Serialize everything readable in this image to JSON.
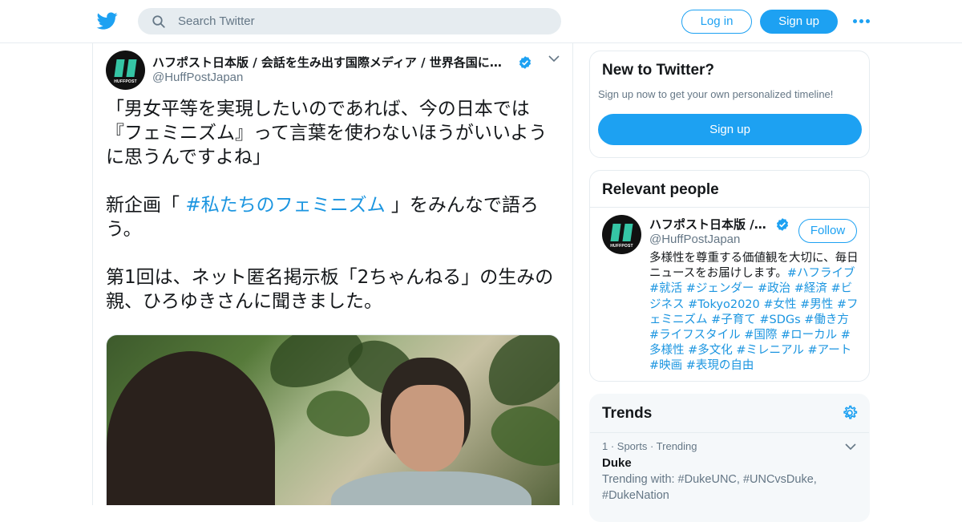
{
  "header": {
    "logo_icon": "twitter-bird-icon",
    "search_placeholder": "Search Twitter",
    "login_label": "Log in",
    "signup_label": "Sign up",
    "more_icon": "more-dots-icon",
    "accent_color": "#1da1f2"
  },
  "tweet": {
    "author_name": "ハフポスト日本版 / 会話を生み出す国際メディア / 世界各国に広がるネットワーク",
    "author_handle": "@HuffPostJapan",
    "avatar_label": "HUFFPOST",
    "verified_icon": "verified-badge-icon",
    "menu_icon": "chevron-down-icon",
    "text_p1": "「男女平等を実現したいのであれば、今の日本では『フェミニズム』って言葉を使わないほうがいいように思うんですよね」",
    "text_p2_before": "新企画「 ",
    "text_p2_hashtag": "#私たちのフェミニズム",
    "text_p2_after": " 」をみんなで語ろう。",
    "text_p3": "第1回は、ネット匿名掲示板「2ちゃんねる」の生みの親、ひろゆきさんに聞きました。",
    "media_type": "photo"
  },
  "sidebar": {
    "new_to_twitter": {
      "title": "New to Twitter?",
      "subtitle": "Sign up now to get your own personalized timeline!",
      "signup_label": "Sign up"
    },
    "relevant_people": {
      "title": "Relevant people",
      "name": "ハフポスト日本版 / 会話を生み出す国際メディア",
      "handle": "@HuffPostJapan",
      "follow_label": "Follow",
      "bio_text": "多様性を尊重する価値観を大切に、毎日ニュースをお届けします。",
      "bio_hashtags": "#ハフライブ #就活 #ジェンダー #政治 #経済 #ビジネス #Tokyo2020 #女性 #男性 #フェミニズム #子育て #SDGs #働き方 #ライフスタイル #国際 #ローカル #多様性 #多文化 #ミレニアル #アート #映画 #表現の自由"
    },
    "trends": {
      "title": "Trends",
      "settings_icon": "gear-icon",
      "items": [
        {
          "meta": "1 · Sports · Trending",
          "name": "Duke",
          "trending_with": "Trending with: #DukeUNC, #UNCvsDuke, #DukeNation"
        }
      ]
    }
  }
}
